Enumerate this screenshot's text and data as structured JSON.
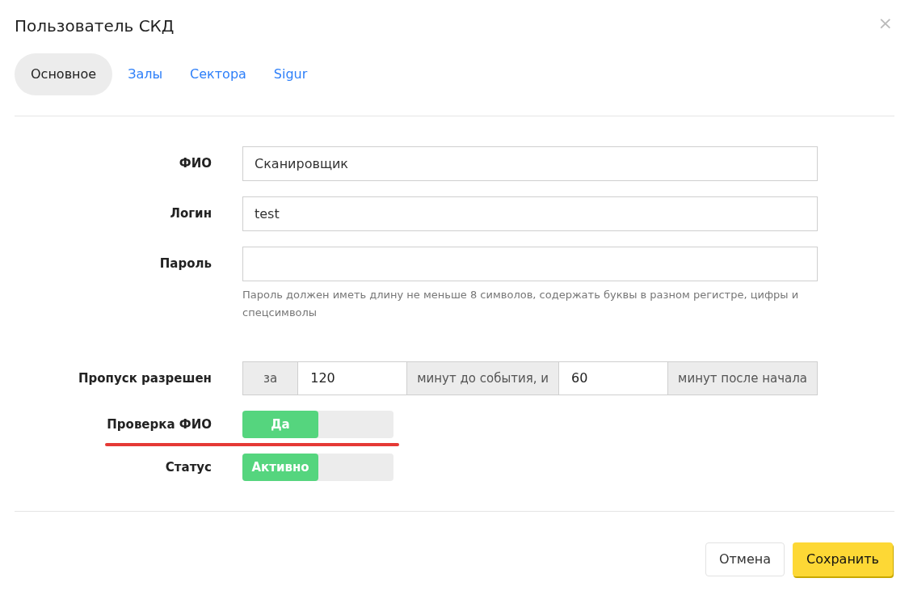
{
  "dialog": {
    "title": "Пользователь СКД",
    "close": "×"
  },
  "tabs": [
    {
      "label": "Основное",
      "selected": true
    },
    {
      "label": "Залы",
      "selected": false
    },
    {
      "label": "Сектора",
      "selected": false
    },
    {
      "label": "Sigur",
      "selected": false
    }
  ],
  "fields": [
    {
      "label": "ФИО",
      "value": "Сканировщик"
    },
    {
      "label": "Логин",
      "value": "test"
    },
    {
      "label": "Пароль",
      "hint": "Пароль должен иметь длину не меньше 8 символов, содержать буквы в разном регистре, цифры и спецсимволы"
    }
  ],
  "pass": {
    "label": "Пропуск разрешен",
    "parts": [
      {
        "kind": "addon",
        "text": "за"
      },
      {
        "kind": "input",
        "text": "120"
      },
      {
        "kind": "addon",
        "text": "минут до события, и"
      },
      {
        "kind": "input",
        "text": "60"
      },
      {
        "kind": "addon",
        "text": "минут после начала"
      }
    ]
  },
  "toggles": [
    {
      "label": "Проверка ФИО",
      "state": "Да",
      "on": true,
      "underlined": true
    },
    {
      "label": "Статус",
      "state": "Активно",
      "on": true,
      "underlined": false
    }
  ],
  "buttons": [
    {
      "label": "Отмена",
      "kind": "secondary"
    },
    {
      "label": "Сохранить",
      "kind": "primary"
    }
  ]
}
